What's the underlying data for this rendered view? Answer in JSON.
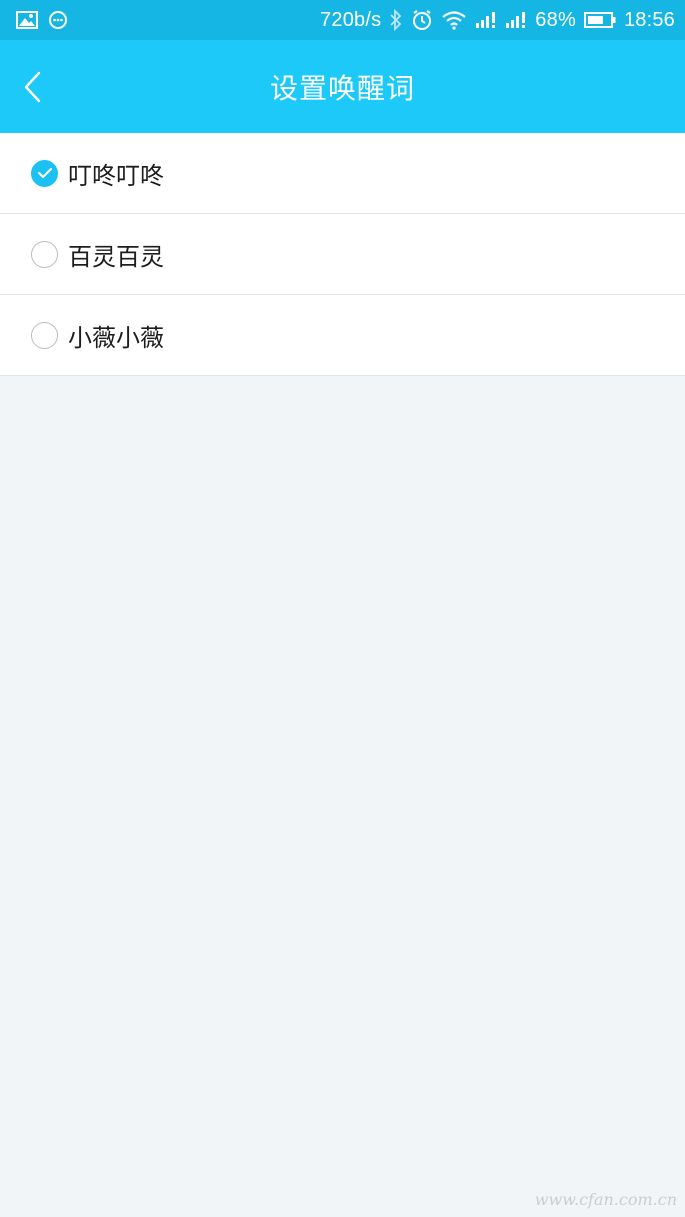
{
  "status_bar": {
    "network_speed": "720b/s",
    "battery_percent": "68%",
    "time": "18:56",
    "icons": [
      "image-icon",
      "message-icon",
      "bluetooth-icon",
      "alarm-icon",
      "wifi-icon",
      "signal-1-icon",
      "signal-2-icon",
      "battery-icon"
    ]
  },
  "header": {
    "title": "设置唤醒词",
    "back_icon": "chevron-left-icon"
  },
  "wake_words": {
    "selected_index": 0,
    "items": [
      {
        "label": "叮咚叮咚",
        "selected": true
      },
      {
        "label": "百灵百灵",
        "selected": false
      },
      {
        "label": "小薇小薇",
        "selected": false
      }
    ]
  },
  "watermark": "www.cfan.com.cn",
  "colors": {
    "status_bar": "#16b6e4",
    "app_bar": "#1cc9f8",
    "accent": "#1cc1f4",
    "background": "#f2f5f7"
  }
}
